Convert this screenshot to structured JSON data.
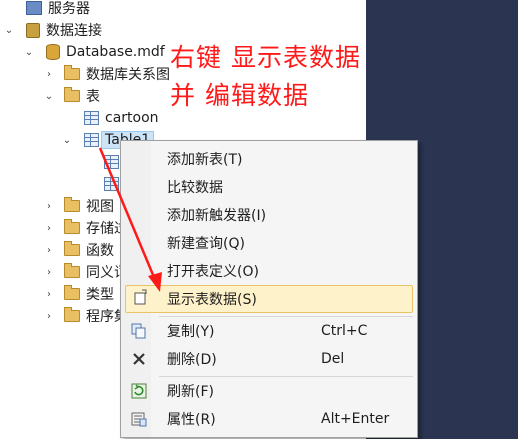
{
  "tree": {
    "server": "服务器",
    "data_connections": "数据连接",
    "database": "Database.mdf",
    "diagrams": "数据库关系图",
    "tables": "表",
    "cartoon": "cartoon",
    "table1": "Table1",
    "views": "视图",
    "stored_procs": "存储过",
    "functions": "函数",
    "synonyms": "同义词",
    "types": "类型",
    "assemblies": "程序集"
  },
  "annotation": {
    "line1": "右键 显示表数据",
    "line2": "并 编辑数据",
    "color": "#ff1a1a"
  },
  "context_menu": {
    "add_table": "添加新表(T)",
    "compare_data": "比较数据",
    "add_trigger": "添加新触发器(I)",
    "new_query": "新建查询(Q)",
    "open_definition": "打开表定义(O)",
    "show_table_data": "显示表数据(S)",
    "copy": "复制(Y)",
    "copy_shortcut": "Ctrl+C",
    "delete": "删除(D)",
    "delete_shortcut": "Del",
    "refresh": "刷新(F)",
    "properties": "属性(R)",
    "properties_shortcut": "Alt+Enter"
  },
  "colors": {
    "right_pane": "#2b3552",
    "highlight": "#fdf2c9"
  }
}
